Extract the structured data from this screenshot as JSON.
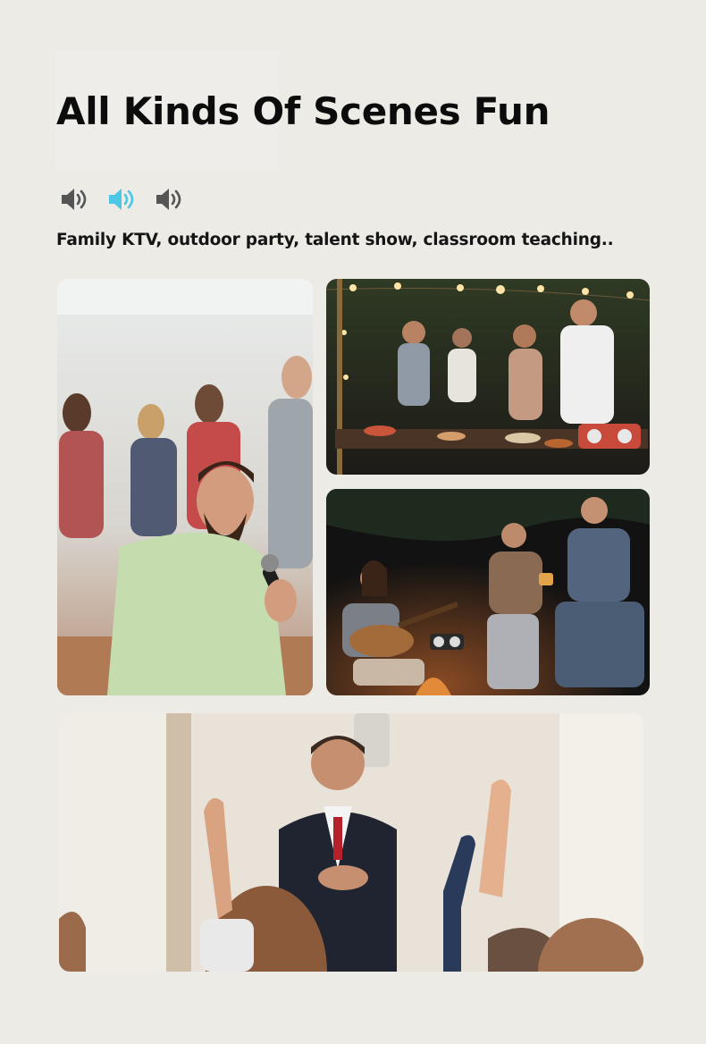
{
  "header": {
    "title": "All Kinds Of Scenes Fun",
    "subtitle": "Family KTV, outdoor party, talent show, classroom teaching.."
  },
  "icons": [
    "speaker-volume-icon",
    "speaker-volume-icon-highlighted",
    "speaker-volume-icon"
  ],
  "colors": {
    "background": "#ecebe6",
    "accent": "#4cc7e6",
    "icon_gray": "#555555",
    "text": "#0c0c0c"
  },
  "photos": [
    {
      "scene": "friends singing karaoke indoors"
    },
    {
      "scene": "outdoor evening dinner party with string lights"
    },
    {
      "scene": "night campfire gathering with guitar"
    },
    {
      "scene": "presenter in suit with raised hands audience"
    }
  ]
}
